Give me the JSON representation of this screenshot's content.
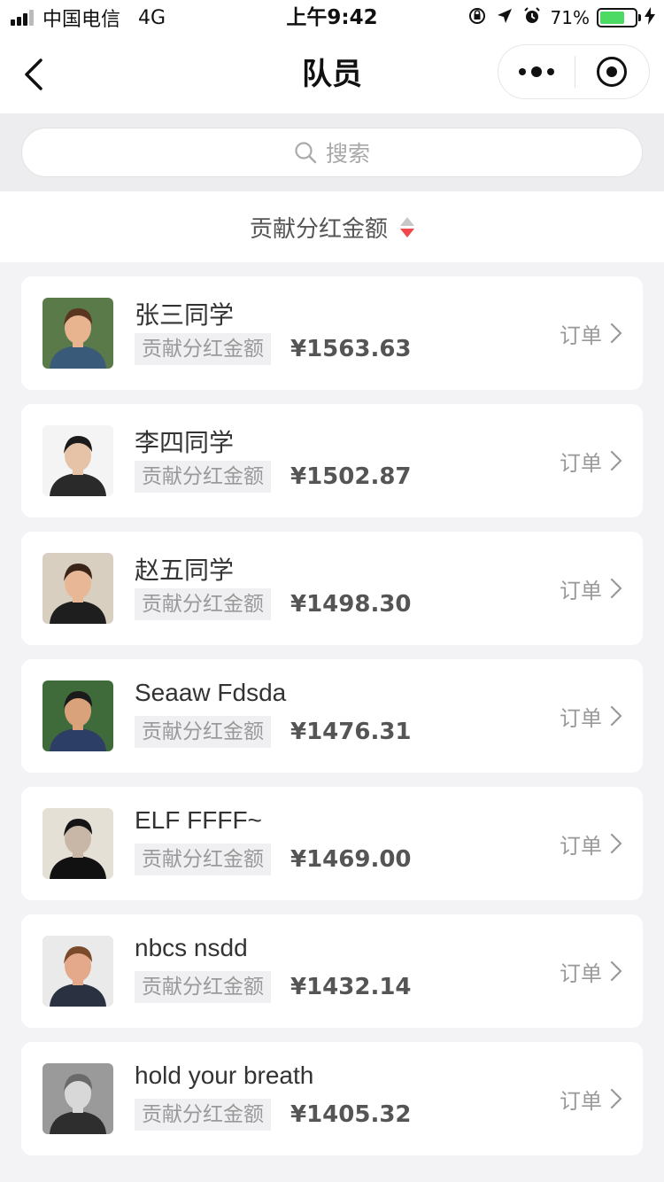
{
  "status_bar": {
    "carrier": "中国电信",
    "network": "4G",
    "time": "上午9:42",
    "battery_percent": "71%",
    "battery_level": 0.71,
    "icons": [
      "rotation-lock-icon",
      "location-arrow-icon",
      "alarm-icon",
      "battery-icon",
      "charging-bolt-icon"
    ]
  },
  "nav": {
    "title": "队员",
    "back_icon": "chevron-left-icon",
    "more_icon": "more-dots-icon",
    "close_icon": "target-circle-icon"
  },
  "search": {
    "placeholder": "搜索"
  },
  "sort": {
    "label": "贡献分红金额",
    "direction": "descending"
  },
  "members": [
    {
      "name": "张三同学",
      "tag": "贡献分红金额",
      "amount": "¥1563.63",
      "order_label": "订单"
    },
    {
      "name": "李四同学",
      "tag": "贡献分红金额",
      "amount": "¥1502.87",
      "order_label": "订单"
    },
    {
      "name": "赵五同学",
      "tag": "贡献分红金额",
      "amount": "¥1498.30",
      "order_label": "订单"
    },
    {
      "name": "Seaaw Fdsda",
      "tag": "贡献分红金额",
      "amount": "¥1476.31",
      "order_label": "订单"
    },
    {
      "name": "ELF FFFF~",
      "tag": "贡献分红金额",
      "amount": "¥1469.00",
      "order_label": "订单"
    },
    {
      "name": "nbcs nsdd",
      "tag": "贡献分红金额",
      "amount": "¥1432.14",
      "order_label": "订单"
    },
    {
      "name": "hold your breath",
      "tag": "贡献分红金额",
      "amount": "¥1405.32",
      "order_label": "订单"
    }
  ],
  "colors": {
    "background": "#f3f3f5",
    "card": "#ffffff",
    "sort_active": "#f0484c",
    "battery": "#4cd964"
  }
}
